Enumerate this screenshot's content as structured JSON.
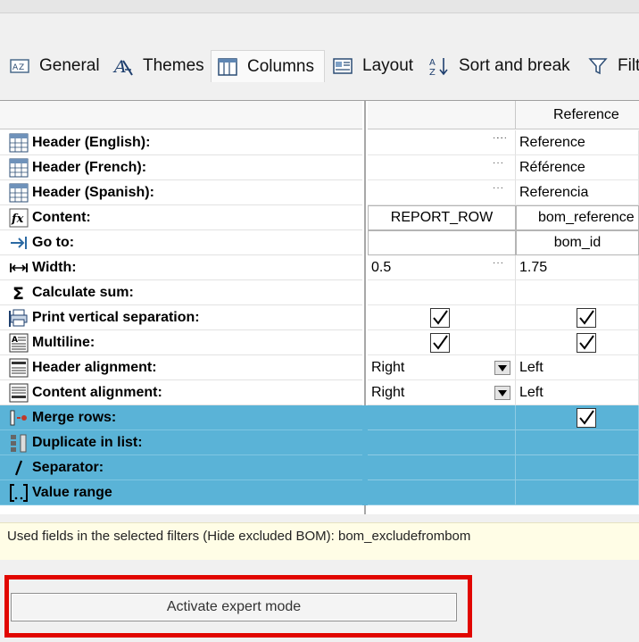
{
  "tabs": [
    {
      "label": "General",
      "icon": "general-icon"
    },
    {
      "label": "Themes",
      "icon": "themes-icon"
    },
    {
      "label": "Columns",
      "icon": "columns-icon"
    },
    {
      "label": "Layout",
      "icon": "layout-icon"
    },
    {
      "label": "Sort and break",
      "icon": "sort-icon"
    },
    {
      "label": "Filt",
      "icon": "filter-icon"
    }
  ],
  "active_tab": "Columns",
  "grid": {
    "column2_header": "Reference",
    "rows": [
      {
        "label": "Header (English):",
        "icon": "header-icon",
        "c1": "",
        "c2": "Reference"
      },
      {
        "label": "Header (French):",
        "icon": "header-icon",
        "c1": "",
        "c2": "Référence"
      },
      {
        "label": "Header (Spanish):",
        "icon": "header-icon",
        "c1": "",
        "c2": "Referencia"
      },
      {
        "label": "Content:",
        "icon": "formula-icon",
        "c1": "REPORT_ROW",
        "c2": "bom_reference"
      },
      {
        "label": "Go to:",
        "icon": "goto-arrow-icon",
        "c1": "",
        "c2": "bom_id"
      },
      {
        "label": "Width:",
        "icon": "width-icon",
        "c1": "0.5",
        "c2": "1.75"
      },
      {
        "label": "Calculate sum:",
        "icon": "sigma-icon",
        "c1": "",
        "c2": ""
      },
      {
        "label": "Print vertical separation:",
        "icon": "printer-icon",
        "c1": "",
        "c2": ""
      },
      {
        "label": "Multiline:",
        "icon": "multiline-icon",
        "c1": "",
        "c2": ""
      },
      {
        "label": "Header alignment:",
        "icon": "header-align-icon",
        "c1": "Right",
        "c2": "Left"
      },
      {
        "label": "Content alignment:",
        "icon": "content-align-icon",
        "c1": "Right",
        "c2": "Left"
      },
      {
        "label": "Merge rows:",
        "icon": "merge-rows-icon",
        "c1": "",
        "c2": ""
      },
      {
        "label": "Duplicate in list:",
        "icon": "duplicate-icon",
        "c1": "",
        "c2": ""
      },
      {
        "label": "Separator:",
        "icon": "separator-slash-icon",
        "c1": "",
        "c2": ""
      },
      {
        "label": "Value range",
        "icon": "value-range-icon",
        "c1": "",
        "c2": ""
      }
    ]
  },
  "checkboxes": {
    "print_vertical_separation": [
      true,
      true
    ],
    "multiline": [
      true,
      true
    ],
    "merge_rows": [
      false,
      true
    ]
  },
  "info_text": "Used fields in the selected filters (Hide excluded BOM): bom_excludefrombom",
  "expert_button_label": "Activate expert mode",
  "colors": {
    "selection": "#5ab3d7",
    "info_background": "#fffde6",
    "highlight_frame": "#e10600"
  }
}
